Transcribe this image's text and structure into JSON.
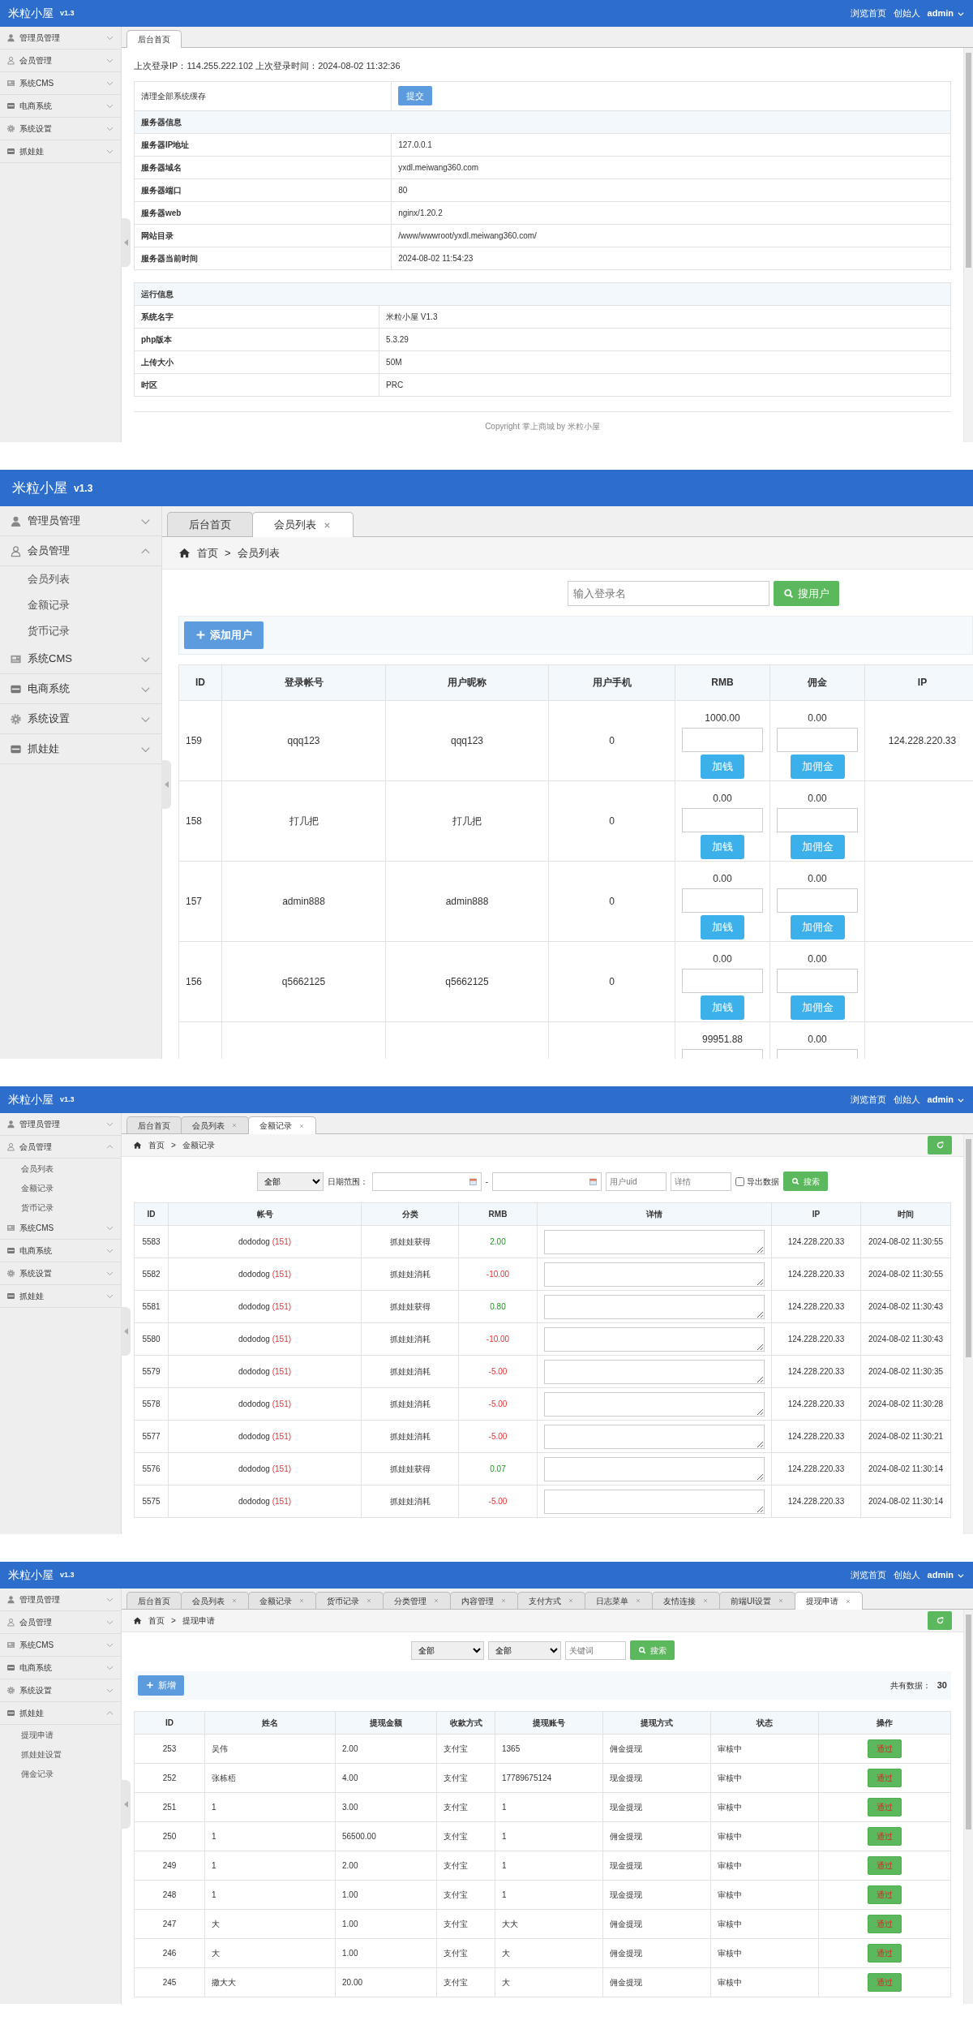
{
  "screens": [
    {
      "kind": "dashboard",
      "header": {
        "brand": "米粒小屋",
        "version": "v1.3",
        "links": [
          "浏览首页",
          "创始人"
        ],
        "user": "admin"
      },
      "sidebar": [
        {
          "label": "管理员管理",
          "expanded": false
        },
        {
          "label": "会员管理",
          "expanded": false
        },
        {
          "label": "系统CMS",
          "expanded": false
        },
        {
          "label": "电商系统",
          "expanded": false
        },
        {
          "label": "系统设置",
          "expanded": false
        },
        {
          "label": "抓娃娃",
          "expanded": false
        }
      ],
      "tabs": [
        {
          "label": "后台首页",
          "selected": true,
          "closable": false
        }
      ],
      "login_info": "上次登录IP：114.255.222.102 上次登录时间：2024-08-02 11:32:36",
      "cache": {
        "label": "清理全部系统缓存",
        "button": "提交"
      },
      "sections": [
        {
          "title": "服务器信息",
          "rows": [
            [
              "服务器IP地址",
              "127.0.0.1"
            ],
            [
              "服务器域名",
              "yxdl.meiwang360.com"
            ],
            [
              "服务器端口",
              "80"
            ],
            [
              "服务器web",
              "nginx/1.20.2"
            ],
            [
              "网站目录",
              "/www/wwwroot/yxdl.meiwang360.com/"
            ],
            [
              "服务器当前时间",
              "2024-08-02 11:54:23"
            ]
          ]
        },
        {
          "title": "运行信息",
          "rows": [
            [
              "系统名字",
              "米粒小屋 V1.3"
            ],
            [
              "php版本",
              "5.3.29"
            ],
            [
              "上传大小",
              "50M"
            ],
            [
              "时区",
              "PRC"
            ]
          ]
        }
      ],
      "footer": {
        "text": "Copyright 掌上商城 by",
        "link": "米粒小屋"
      }
    },
    {
      "kind": "members",
      "header": {
        "brand": "米粒小屋",
        "version": "v1.3"
      },
      "sidebar": [
        {
          "label": "管理员管理",
          "expanded": false
        },
        {
          "label": "会员管理",
          "expanded": true,
          "children": [
            "会员列表",
            "金额记录",
            "货币记录"
          ]
        },
        {
          "label": "系统CMS",
          "expanded": false
        },
        {
          "label": "电商系统",
          "expanded": false
        },
        {
          "label": "系统设置",
          "expanded": false
        },
        {
          "label": "抓娃娃",
          "expanded": false
        }
      ],
      "tabs": [
        {
          "label": "后台首页",
          "selected": false,
          "closable": false
        },
        {
          "label": "会员列表",
          "selected": true,
          "closable": true
        }
      ],
      "breadcrumb": [
        "首页",
        "会员列表"
      ],
      "breadcrumb_separator": ">",
      "search": {
        "placeholder": "输入登录名",
        "button": "搜用户"
      },
      "add_button": "添加用户",
      "table": {
        "columns": [
          "ID",
          "登录帐号",
          "用户昵称",
          "用户手机",
          "RMB",
          "佣金",
          "IP"
        ],
        "rows": [
          {
            "id": "159",
            "account": "qqq123",
            "nickname": "qqq123",
            "phone": "0",
            "rmb": "1000.00",
            "rmb_button": "加钱",
            "commission": "0.00",
            "commission_button": "加佣金",
            "ip": "124.228.220.33"
          },
          {
            "id": "158",
            "account": "打几把",
            "nickname": "打几把",
            "phone": "0",
            "rmb": "0.00",
            "rmb_button": "加钱",
            "commission": "0.00",
            "commission_button": "加佣金"
          },
          {
            "id": "157",
            "account": "admin888",
            "nickname": "admin888",
            "phone": "0",
            "rmb": "0.00",
            "rmb_button": "加钱",
            "commission": "0.00",
            "commission_button": "加佣金"
          },
          {
            "id": "156",
            "account": "q5662125",
            "nickname": "q5662125",
            "phone": "0",
            "rmb": "0.00",
            "rmb_button": "加钱",
            "commission": "0.00",
            "commission_button": "加佣金"
          },
          {
            "rmb": "99951.88",
            "commission": "0.00"
          }
        ]
      }
    },
    {
      "kind": "money",
      "header": {
        "brand": "米粒小屋",
        "version": "v1.3",
        "links": [
          "浏览首页",
          "创始人"
        ],
        "user": "admin"
      },
      "sidebar": [
        {
          "label": "管理员管理",
          "expanded": false
        },
        {
          "label": "会员管理",
          "expanded": true,
          "children": [
            "会员列表",
            "金额记录",
            "货币记录"
          ]
        },
        {
          "label": "系统CMS",
          "expanded": false
        },
        {
          "label": "电商系统",
          "expanded": false
        },
        {
          "label": "系统设置",
          "expanded": false
        },
        {
          "label": "抓娃娃",
          "expanded": false
        }
      ],
      "tabs": [
        {
          "label": "后台首页",
          "selected": false,
          "closable": false
        },
        {
          "label": "会员列表",
          "selected": false,
          "closable": true
        },
        {
          "label": "金额记录",
          "selected": true,
          "closable": true
        }
      ],
      "breadcrumb": [
        "首页",
        "金额记录"
      ],
      "breadcrumb_separator": ">",
      "refresh": true,
      "filter": {
        "type": "全部",
        "date_label": "日期范围：",
        "date_separator": "-",
        "uid_placeholder": "用户uid",
        "detail_placeholder": "详情",
        "export_label": "导出数据",
        "export_checked": false,
        "button": "搜索"
      },
      "table": {
        "columns": [
          "ID",
          "帐号",
          "分类",
          "RMB",
          "详情",
          "IP",
          "时间"
        ],
        "rows": [
          {
            "id": "5583",
            "account": "dododog",
            "uid": "(151)",
            "category": "抓娃娃获得",
            "kind": "gain",
            "amount": "2.00",
            "ip": "124.228.220.33",
            "time": "2024-08-02 11:30:55"
          },
          {
            "id": "5582",
            "account": "dododog",
            "uid": "(151)",
            "category": "抓娃娃消耗",
            "kind": "loss",
            "amount": "-10.00",
            "ip": "124.228.220.33",
            "time": "2024-08-02 11:30:55"
          },
          {
            "id": "5581",
            "account": "dododog",
            "uid": "(151)",
            "category": "抓娃娃获得",
            "kind": "gain",
            "amount": "0.80",
            "ip": "124.228.220.33",
            "time": "2024-08-02 11:30:43"
          },
          {
            "id": "5580",
            "account": "dododog",
            "uid": "(151)",
            "category": "抓娃娃消耗",
            "kind": "loss",
            "amount": "-10.00",
            "ip": "124.228.220.33",
            "time": "2024-08-02 11:30:43"
          },
          {
            "id": "5579",
            "account": "dododog",
            "uid": "(151)",
            "category": "抓娃娃消耗",
            "kind": "loss",
            "amount": "-5.00",
            "ip": "124.228.220.33",
            "time": "2024-08-02 11:30:35"
          },
          {
            "id": "5578",
            "account": "dododog",
            "uid": "(151)",
            "category": "抓娃娃消耗",
            "kind": "loss",
            "amount": "-5.00",
            "ip": "124.228.220.33",
            "time": "2024-08-02 11:30:28"
          },
          {
            "id": "5577",
            "account": "dododog",
            "uid": "(151)",
            "category": "抓娃娃消耗",
            "kind": "loss",
            "amount": "-5.00",
            "ip": "124.228.220.33",
            "time": "2024-08-02 11:30:21"
          },
          {
            "id": "5576",
            "account": "dododog",
            "uid": "(151)",
            "category": "抓娃娃获得",
            "kind": "gain",
            "amount": "0.07",
            "ip": "124.228.220.33",
            "time": "2024-08-02 11:30:14"
          },
          {
            "id": "5575",
            "account": "dododog",
            "uid": "(151)",
            "category": "抓娃娃消耗",
            "kind": "loss",
            "amount": "-5.00",
            "ip": "124.228.220.33",
            "time": "2024-08-02 11:30:14"
          }
        ]
      }
    },
    {
      "kind": "withdraw",
      "header": {
        "brand": "米粒小屋",
        "version": "v1.3",
        "links": [
          "浏览首页",
          "创始人"
        ],
        "user": "admin"
      },
      "sidebar": [
        {
          "label": "管理员管理",
          "expanded": false
        },
        {
          "label": "会员管理",
          "expanded": false
        },
        {
          "label": "系统CMS",
          "expanded": false
        },
        {
          "label": "电商系统",
          "expanded": false
        },
        {
          "label": "系统设置",
          "expanded": false
        },
        {
          "label": "抓娃娃",
          "expanded": true,
          "children": [
            "提现申请",
            "抓娃娃设置",
            "佣金记录"
          ]
        }
      ],
      "tabs": [
        {
          "label": "后台首页",
          "selected": false,
          "closable": false
        },
        {
          "label": "会员列表",
          "selected": false,
          "closable": true
        },
        {
          "label": "金额记录",
          "selected": false,
          "closable": true
        },
        {
          "label": "货币记录",
          "selected": false,
          "closable": true
        },
        {
          "label": "分类管理",
          "selected": false,
          "closable": true
        },
        {
          "label": "内容管理",
          "selected": false,
          "closable": true
        },
        {
          "label": "支付方式",
          "selected": false,
          "closable": true
        },
        {
          "label": "日志菜单",
          "selected": false,
          "closable": true
        },
        {
          "label": "友情连接",
          "selected": false,
          "closable": true
        },
        {
          "label": "前端UI设置",
          "selected": false,
          "closable": true
        },
        {
          "label": "提现申请",
          "selected": true,
          "closable": true
        }
      ],
      "breadcrumb": [
        "首页",
        "提现申请"
      ],
      "breadcrumb_separator": ">",
      "refresh": true,
      "filter": {
        "selects": [
          "全部",
          "全部"
        ],
        "keyword_placeholder": "关键词",
        "button": "搜索"
      },
      "add_button": "新增",
      "total_label": "共有数据：",
      "total": "30",
      "table": {
        "columns": [
          "ID",
          "姓名",
          "提现金额",
          "收款方式",
          "提现账号",
          "提现方式",
          "状态",
          "操作"
        ],
        "rows": [
          {
            "id": "253",
            "name": "吴伟",
            "amount": "2.00",
            "method": "支付宝",
            "account": "1365",
            "type": "佣金提现",
            "status": "审核中",
            "action": "通过"
          },
          {
            "id": "252",
            "name": "张栋梧",
            "amount": "4.00",
            "method": "支付宝",
            "account": "17789675124",
            "type": "现金提现",
            "status": "审核中",
            "action": "通过"
          },
          {
            "id": "251",
            "name": "1",
            "amount": "3.00",
            "method": "支付宝",
            "account": "1",
            "type": "现金提现",
            "status": "审核中",
            "action": "通过"
          },
          {
            "id": "250",
            "name": "1",
            "amount": "56500.00",
            "method": "支付宝",
            "account": "1",
            "type": "佣金提现",
            "status": "审核中",
            "action": "通过"
          },
          {
            "id": "249",
            "name": "1",
            "amount": "2.00",
            "method": "支付宝",
            "account": "1",
            "type": "现金提现",
            "status": "审核中",
            "action": "通过"
          },
          {
            "id": "248",
            "name": "1",
            "amount": "1.00",
            "method": "支付宝",
            "account": "1",
            "type": "现金提现",
            "status": "审核中",
            "action": "通过"
          },
          {
            "id": "247",
            "name": "大",
            "amount": "1.00",
            "method": "支付宝",
            "account": "大大",
            "type": "佣金提现",
            "status": "审核中",
            "action": "通过"
          },
          {
            "id": "246",
            "name": "大",
            "amount": "1.00",
            "method": "支付宝",
            "account": "大",
            "type": "佣金提现",
            "status": "审核中",
            "action": "通过"
          },
          {
            "id": "245",
            "name": "撒大大",
            "amount": "20.00",
            "method": "支付宝",
            "account": "大",
            "type": "佣金提现",
            "status": "审核中",
            "action": "通过"
          }
        ]
      }
    }
  ]
}
